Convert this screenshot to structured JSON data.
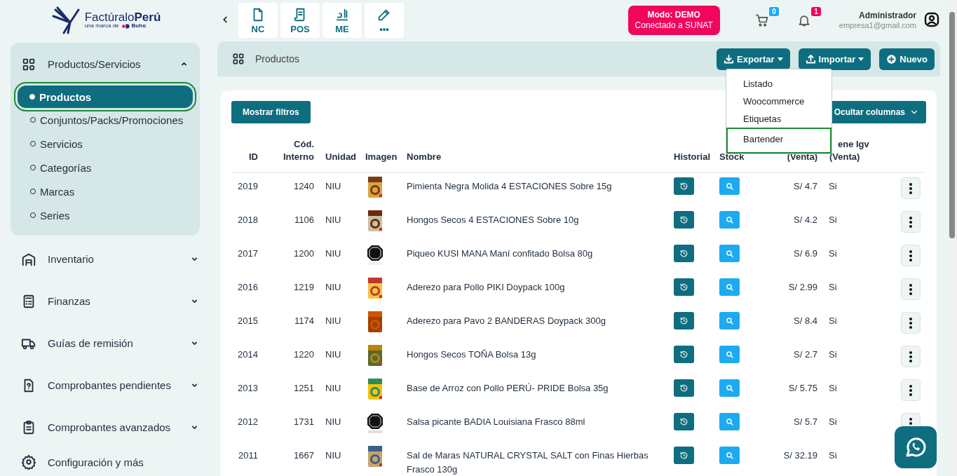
{
  "logo": {
    "name": "Factúralo**Perú**",
    "tagline": "una marca de",
    "brand": "Buho"
  },
  "quick_actions": [
    {
      "label": "NC",
      "kind": "document"
    },
    {
      "label": "POS",
      "kind": "receipt"
    },
    {
      "label": "ME",
      "kind": "scale"
    },
    {
      "label": "•••",
      "kind": "pencil"
    }
  ],
  "mode_badge": {
    "title": "Modo: DEMO",
    "subtitle": "Conectado a SUNAT"
  },
  "cart": {
    "count": "0"
  },
  "notifications": {
    "count": "1"
  },
  "user": {
    "name": "Administrador",
    "email": "empresa1@gmail.com"
  },
  "sidebar": {
    "groups": [
      {
        "label": "Productos/Servicios",
        "kind": "grid",
        "expanded": true,
        "children": [
          {
            "label": "Productos",
            "selected": true
          },
          {
            "label": "Conjuntos/Packs/Promociones",
            "selected": false
          },
          {
            "label": "Servicios",
            "selected": false
          },
          {
            "label": "Categorías",
            "selected": false
          },
          {
            "label": "Marcas",
            "selected": false
          },
          {
            "label": "Series",
            "selected": false
          }
        ]
      },
      {
        "label": "Inventario",
        "kind": "warehouse",
        "expanded": false
      },
      {
        "label": "Finanzas",
        "kind": "calculator",
        "expanded": false
      },
      {
        "label": "Guías de remisión",
        "kind": "truck",
        "expanded": false
      },
      {
        "label": "Comprobantes pendientes",
        "kind": "file-question",
        "expanded": false
      },
      {
        "label": "Comprobantes avanzados",
        "kind": "clipboard",
        "expanded": false
      },
      {
        "label": "Configuración y más",
        "kind": "gear"
      }
    ]
  },
  "breadcrumb": {
    "title": "Productos"
  },
  "toolbar": {
    "buttons": [
      {
        "label": "Exportar",
        "kind": "download",
        "dropdown": true
      },
      {
        "label": "Importar",
        "kind": "upload",
        "dropdown": true
      },
      {
        "label": "Nuevo",
        "kind": "add",
        "dropdown": false
      }
    ]
  },
  "export_menu": {
    "items": [
      {
        "label": "Listado",
        "highlighted": false
      },
      {
        "label": "Woocommerce",
        "highlighted": false
      },
      {
        "label": "Etiquetas",
        "highlighted": false
      },
      {
        "label": "Bartender",
        "highlighted": true
      }
    ]
  },
  "filters_button": "Mostrar filtros",
  "columns_button": "Ocultar columnas",
  "table": {
    "columns": [
      "ID",
      "Cód. Interno",
      "Unidad",
      "Imagen",
      "Nombre",
      "Historial",
      "Stock",
      "(Venta)",
      "ene Igv (Venta)"
    ],
    "rows": [
      {
        "id": "2019",
        "code": "1240",
        "unit": "NIU",
        "name": "Pimienta Negra Molida 4 ESTACIONES Sobre 15g",
        "price": "S/ 4.7",
        "igv": "Si"
      },
      {
        "id": "2018",
        "code": "1106",
        "unit": "NIU",
        "name": "Hongos Secos 4 ESTACIONES Sobre 10g",
        "price": "S/ 4.2",
        "igv": "Si"
      },
      {
        "id": "2017",
        "code": "1200",
        "unit": "NIU",
        "name": "Piqueo KUSI MANA Maní confitado Bolsa 80g",
        "price": "S/ 6.9",
        "igv": "Si"
      },
      {
        "id": "2016",
        "code": "1219",
        "unit": "NIU",
        "name": "Aderezo para Pollo PIKI Doypack 100g",
        "price": "S/ 2.99",
        "igv": "Si"
      },
      {
        "id": "2015",
        "code": "1174",
        "unit": "NIU",
        "name": "Aderezo para Pavo 2 BANDERAS Doypack 300g",
        "price": "S/ 8.4",
        "igv": "Si"
      },
      {
        "id": "2014",
        "code": "1220",
        "unit": "NIU",
        "name": "Hongos Secos TOÑA Bolsa 13g",
        "price": "S/ 2.7",
        "igv": "Si"
      },
      {
        "id": "2013",
        "code": "1251",
        "unit": "NIU",
        "name": "Base de Arroz con Pollo PERÚ- PRIDE Bolsa 35g",
        "price": "S/ 5.75",
        "igv": "Si"
      },
      {
        "id": "2012",
        "code": "1731",
        "unit": "NIU",
        "name": "Salsa picante BADIA Louisiana Frasco 88ml",
        "price": "S/ 5.7",
        "igv": "Si"
      },
      {
        "id": "2011",
        "code": "1667",
        "unit": "NIU",
        "name": "Sal de Maras NATURAL CRYSTAL SALT con Finas Hierbas Frasco 130g",
        "price": "S/ 32.19",
        "igv": "Si"
      }
    ]
  }
}
